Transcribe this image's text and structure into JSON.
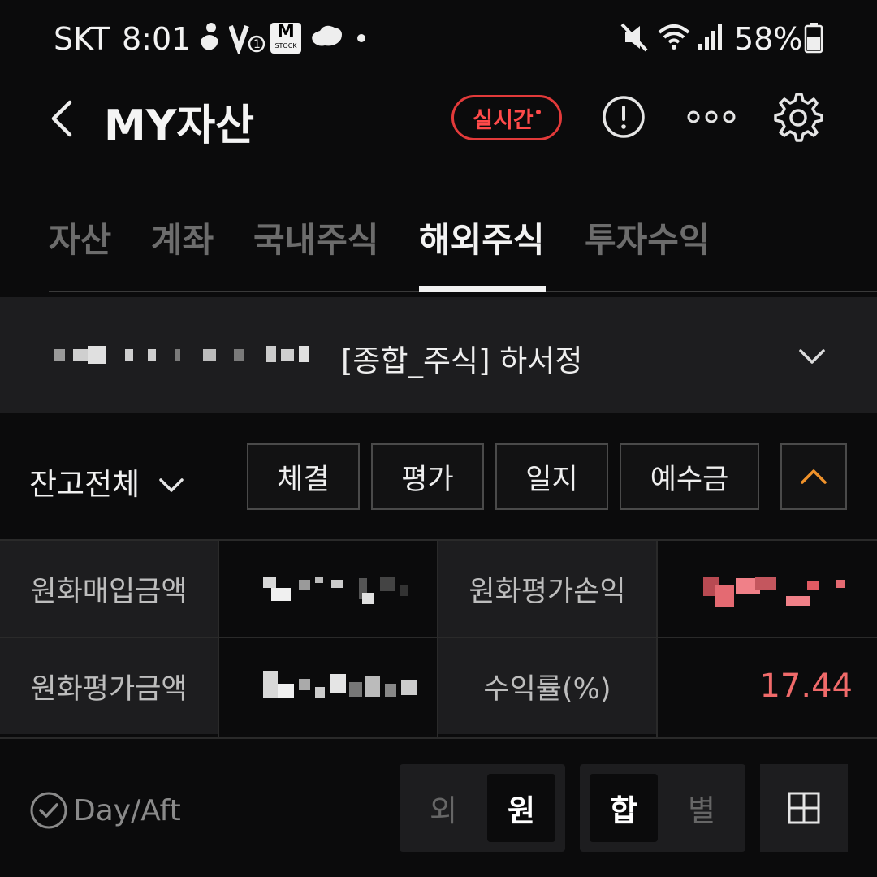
{
  "status_bar": {
    "carrier": "SKT",
    "time": "8:01",
    "battery": "58%",
    "left_icons": [
      "notification-icon",
      "v1-app-icon",
      "mstock-app-icon",
      "cloud-app-icon",
      "dot-icon"
    ],
    "right_icons": [
      "mute-icon",
      "wifi-icon",
      "signal-icon",
      "battery-icon"
    ],
    "mstock_badge": "M",
    "mstock_sub": "STOCK"
  },
  "header": {
    "title": "MY자산",
    "live_label": "실시간",
    "icons": [
      "back-icon",
      "info-icon",
      "more-icon",
      "settings-icon"
    ]
  },
  "tabs": [
    {
      "label": "자산",
      "active": false
    },
    {
      "label": "계좌",
      "active": false
    },
    {
      "label": "국내주식",
      "active": false
    },
    {
      "label": "해외주식",
      "active": true
    },
    {
      "label": "투자수익",
      "active": false
    }
  ],
  "account": {
    "name": "[종합_주식] 하서정"
  },
  "controls": {
    "balance_selector": "잔고전체",
    "buttons": [
      "체결",
      "평가",
      "일지",
      "예수금"
    ]
  },
  "summary": {
    "krw_purchase_label": "원화매입금액",
    "krw_pl_label": "원화평가손익",
    "krw_eval_label": "원화평가금액",
    "return_rate_label": "수익률(%)",
    "return_rate_value": "17.44"
  },
  "bottom": {
    "day_aft": "Day/Aft",
    "currency_toggle": {
      "foreign": "외",
      "krw": "원",
      "selected": "원"
    },
    "view_toggle": {
      "sum": "합",
      "each": "별",
      "selected": "합"
    }
  },
  "colors": {
    "accent_red": "#ff4a4a",
    "positive_value": "#f06a6a",
    "chevron_orange": "#f0922a",
    "background": "#0b0b0c",
    "panel": "#1d1d1f"
  }
}
